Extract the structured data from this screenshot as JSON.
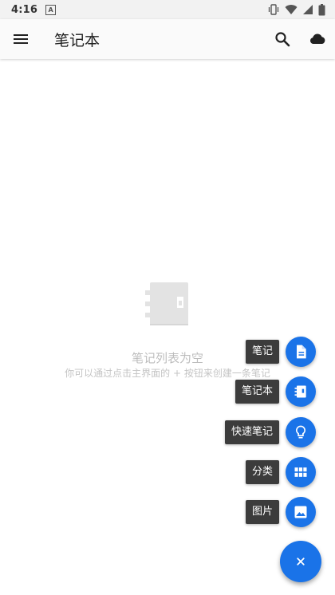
{
  "status_bar": {
    "time": "4:16",
    "notification_letter": "A",
    "icons": [
      "vibrate-icon",
      "wifi-icon",
      "signal-icon",
      "battery-icon"
    ]
  },
  "app_bar": {
    "title": "笔记本",
    "left_icon": "menu-icon",
    "right_icons": [
      "search-icon",
      "cloud-icon"
    ]
  },
  "empty_state": {
    "icon": "notebook-icon",
    "title": "笔记列表为空",
    "subtitle": "你可以通过点击主界面的 + 按钮来创建一条笔记"
  },
  "fab_menu": {
    "items": [
      {
        "label": "笔记",
        "icon": "note-icon"
      },
      {
        "label": "笔记本",
        "icon": "notebook-icon"
      },
      {
        "label": "快速笔记",
        "icon": "lightbulb-icon"
      },
      {
        "label": "分类",
        "icon": "grid-icon"
      },
      {
        "label": "图片",
        "icon": "image-icon"
      }
    ],
    "main_icon": "close-icon"
  },
  "colors": {
    "accent": "#1a73e8",
    "label_bg": "#3c3c3c",
    "empty_text": "#bdbdbd"
  }
}
